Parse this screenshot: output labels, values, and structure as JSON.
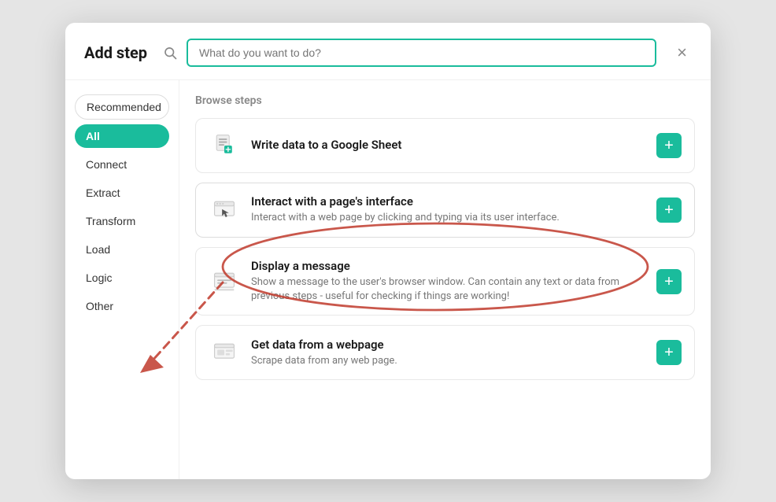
{
  "modal": {
    "title": "Add step",
    "close_label": "×",
    "search_placeholder": "What do you want to do?"
  },
  "sidebar": {
    "items": [
      {
        "id": "recommended",
        "label": "Recommended",
        "active": false,
        "special": true
      },
      {
        "id": "all",
        "label": "All",
        "active": true
      },
      {
        "id": "connect",
        "label": "Connect",
        "active": false
      },
      {
        "id": "extract",
        "label": "Extract",
        "active": false
      },
      {
        "id": "transform",
        "label": "Transform",
        "active": false
      },
      {
        "id": "load",
        "label": "Load",
        "active": false
      },
      {
        "id": "logic",
        "label": "Logic",
        "active": false
      },
      {
        "id": "other",
        "label": "Other",
        "active": false
      }
    ]
  },
  "main": {
    "browse_title": "Browse steps",
    "steps": [
      {
        "id": "google-sheet",
        "name": "Write data to a Google Sheet",
        "desc": "",
        "add_label": "+"
      },
      {
        "id": "interact-page",
        "name": "Interact with a page's interface",
        "desc": "Interact with a web page by clicking and typing via its user interface.",
        "add_label": "+"
      },
      {
        "id": "display-message",
        "name": "Display a message",
        "desc": "Show a message to the user's browser window. Can contain any text or data from previous steps - useful for checking if things are working!",
        "add_label": "+"
      },
      {
        "id": "get-webpage",
        "name": "Get data from a webpage",
        "desc": "Scrape data from any web page.",
        "add_label": "+"
      }
    ]
  },
  "colors": {
    "teal": "#1abc9c",
    "annotation_red": "#c0392b"
  }
}
